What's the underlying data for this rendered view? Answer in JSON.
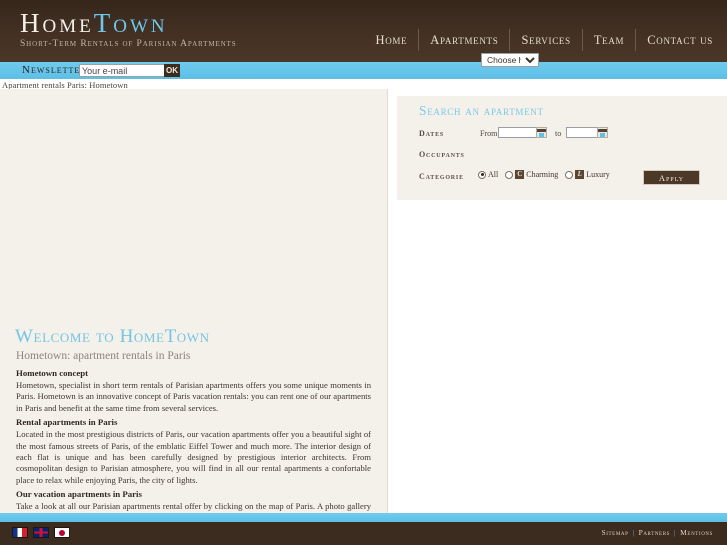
{
  "header": {
    "logo_primary": "Home",
    "logo_secondary": "Town",
    "tagline": "Short-Term Rentals of Parisian Apartments",
    "nav": [
      {
        "label": "Home",
        "name": "nav-home"
      },
      {
        "label": "Apartments",
        "name": "nav-apartments"
      },
      {
        "label": "Services",
        "name": "nav-services"
      },
      {
        "label": "Team",
        "name": "nav-team"
      },
      {
        "label": "Contact us",
        "name": "nav-contact-us"
      }
    ]
  },
  "newsletter": {
    "label": "Newsletter",
    "input_value": "Your e-mail",
    "placeholder": "Your e-mail",
    "submit_label": "OK"
  },
  "breadcrumb": "Apartment rentals Paris: Hometown",
  "search": {
    "title": "Search an apartment",
    "dates_label": "Dates",
    "from_label": "From",
    "to_label": "to",
    "from_value": "",
    "to_value": "",
    "calendar_icon": "calendar-icon",
    "occupants_label": "Occupants",
    "occupants_selected": "Choose here",
    "occupants_options": [
      "Choose here"
    ],
    "categorie_label": "Categorie",
    "categories": [
      {
        "label": "All",
        "checked": true,
        "badge": ""
      },
      {
        "label": "Charming",
        "checked": false,
        "badge": "C"
      },
      {
        "label": "Luxury",
        "checked": false,
        "badge": "L"
      }
    ],
    "apply_label": "Apply"
  },
  "main": {
    "title": "Welcome to HomeTown",
    "subtitle": "Hometown: apartment rentals in Paris",
    "sections": [
      {
        "heading": "Hometown concept",
        "body": "Hometown, specialist in short term rentals of Parisian apartments offers you some unique moments in Paris. Hometown is an innovative concept of Paris vacation rentals: you can rent one of our apartments in Paris and benefit at the same time from several services."
      },
      {
        "heading": "Rental apartments in Paris",
        "body": "Located in the most prestigious districts of Paris, our vacation apartments offer you a beautiful sight of the most famous streets of Paris, of the emblatic Eiffel Tower and much more. The interior design of each flat is unique and has been carefully designed by prestigious interior architects. From cosmopolitan design to Parisian atmosphere, you will find in all our rental apartments a confortable place to relax while enjoying Paris, the city of lights."
      },
      {
        "heading": "Our vacation apartments in Paris",
        "body": "Take a look at all our Parisian apartments rental offer by clicking on the map of Paris. A photo gallery will drive your imagination through the refined atmosphere in all our Paris rental apartments. We warmly welcome you in one of our vacation apartments in Paris."
      }
    ]
  },
  "footer": {
    "languages": [
      {
        "name": "flag-fr-icon",
        "title": "French"
      },
      {
        "name": "flag-uk-icon",
        "title": "English"
      },
      {
        "name": "flag-jp-icon",
        "title": "Japanese"
      }
    ],
    "links": [
      {
        "label": "Sitemap"
      },
      {
        "label": "Partners"
      },
      {
        "label": "Mentions"
      }
    ],
    "separator": "|"
  },
  "colors": {
    "brown": "#3c2c1f",
    "blue": "#66c6ea",
    "beige": "#f4f1ea",
    "accent_text": "#7cc8e6"
  }
}
